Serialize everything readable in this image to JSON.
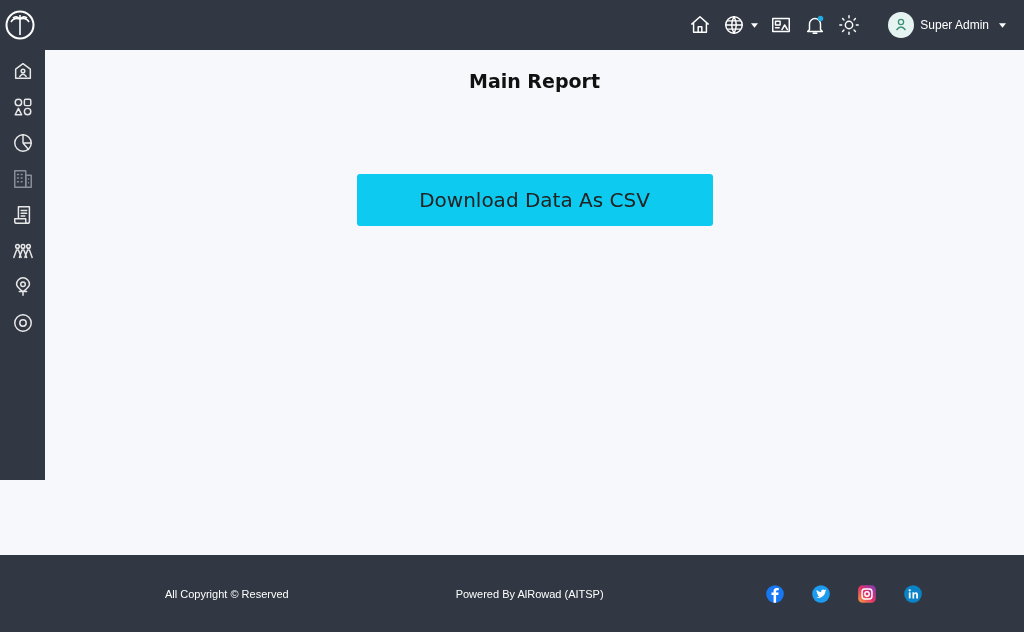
{
  "header": {
    "user_name": "Super Admin"
  },
  "sidebar": {
    "items": [
      {
        "kind": "home",
        "disabled": false
      },
      {
        "kind": "shapes",
        "disabled": false
      },
      {
        "kind": "chart",
        "disabled": false
      },
      {
        "kind": "building",
        "disabled": true
      },
      {
        "kind": "document",
        "disabled": false
      },
      {
        "kind": "people",
        "disabled": false
      },
      {
        "kind": "pin",
        "disabled": false
      },
      {
        "kind": "target",
        "disabled": false
      }
    ]
  },
  "main": {
    "title": "Main Report",
    "button": "Download Data As CSV"
  },
  "footer": {
    "copyright": "All Copyright © Reserved",
    "powered_by": "Powered By AlRowad (AITSP)",
    "social": [
      {
        "kind": "facebook"
      },
      {
        "kind": "twitter"
      },
      {
        "kind": "instagram"
      },
      {
        "kind": "linkedin"
      }
    ]
  }
}
